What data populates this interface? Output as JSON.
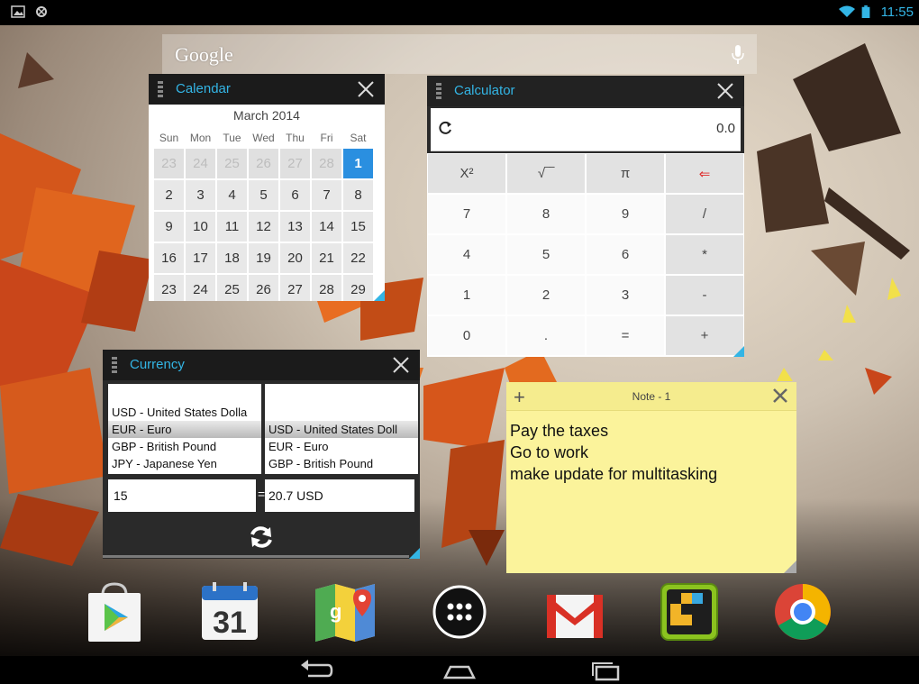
{
  "status_bar": {
    "left_icons": [
      "image-icon",
      "usb-debug-icon"
    ],
    "right_icons": [
      "wifi-icon",
      "battery-icon"
    ],
    "time": "11:55",
    "accent": "#33b5e5"
  },
  "search": {
    "logo": "Google",
    "mic_icon": "mic-icon"
  },
  "calendar": {
    "title": "Calendar",
    "month": "March 2014",
    "weekdays": [
      "Sun",
      "Mon",
      "Tue",
      "Wed",
      "Thu",
      "Fri",
      "Sat"
    ],
    "weeks": [
      [
        "23",
        "24",
        "25",
        "26",
        "27",
        "28",
        "1"
      ],
      [
        "2",
        "3",
        "4",
        "5",
        "6",
        "7",
        "8"
      ],
      [
        "9",
        "10",
        "11",
        "12",
        "13",
        "14",
        "15"
      ],
      [
        "16",
        "17",
        "18",
        "19",
        "20",
        "21",
        "22"
      ],
      [
        "23",
        "24",
        "25",
        "26",
        "27",
        "28",
        "29"
      ]
    ],
    "today_color": "#2a8fe0"
  },
  "calculator": {
    "title": "Calculator",
    "display": "0.0",
    "rows": [
      [
        "X²",
        "√‾‾",
        "π",
        "⇐"
      ],
      [
        "7",
        "8",
        "9",
        "/"
      ],
      [
        "4",
        "5",
        "6",
        "*"
      ],
      [
        "1",
        "2",
        "3",
        "-"
      ],
      [
        "0",
        ".",
        "=",
        "+"
      ]
    ]
  },
  "currency": {
    "title": "Currency",
    "from_list": [
      "USD - United States Dolla",
      "EUR - Euro",
      "GBP - British Pound",
      "JPY - Japanese Yen"
    ],
    "to_list": [
      "USD - United States Doll",
      "EUR - Euro",
      "GBP - British Pound"
    ],
    "amount": "15",
    "equals": "=",
    "result": "20.7 USD"
  },
  "note": {
    "title": "Note - 1",
    "plus": "+",
    "lines": [
      "Pay the taxes",
      "Go to work",
      "make update for multitasking"
    ]
  },
  "dock": {
    "apps": [
      "play-store-icon",
      "calendar-app-icon",
      "maps-icon",
      "app-drawer-icon",
      "gmail-icon",
      "game-icon",
      "chrome-icon"
    ],
    "calendar_app_day": "31"
  },
  "nav": {
    "buttons": [
      "back-icon",
      "home-icon",
      "recents-icon"
    ]
  }
}
